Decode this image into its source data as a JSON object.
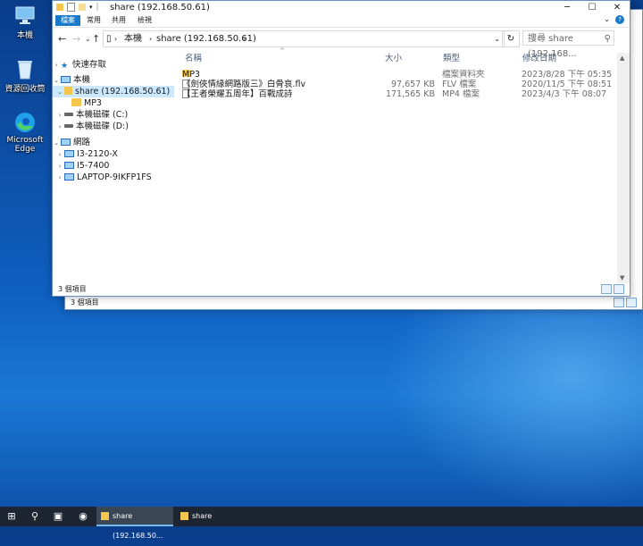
{
  "desktop": {
    "icons": [
      {
        "label": "本機"
      },
      {
        "label": "資源回收筒"
      },
      {
        "label": "Microsoft Edge"
      }
    ]
  },
  "back_window": {
    "status": "3 個項目"
  },
  "window": {
    "title": "share (192.168.50.61)",
    "ribbon_tabs": [
      "檔案",
      "常用",
      "共用",
      "檢視"
    ],
    "address": {
      "segments": [
        "本機",
        "share (192.168.50.61)"
      ]
    },
    "search_placeholder": "搜尋 share (192.168.50.61)",
    "search_display": "搜尋 share (192.168...",
    "nav_pane": [
      {
        "label": "快速存取"
      },
      {
        "label": "本機"
      },
      {
        "label": "share (192.168.50.61)"
      },
      {
        "label": "MP3"
      },
      {
        "label": "本機磁碟 (C:)"
      },
      {
        "label": "本機磁碟 (D:)"
      },
      {
        "label": "網路"
      },
      {
        "label": "I3-2120-X"
      },
      {
        "label": "I5-7400"
      },
      {
        "label": "LAPTOP-9IKFP1FS"
      }
    ],
    "columns": {
      "name": "名稱",
      "size": "大小",
      "type": "類型",
      "date": "修改日期"
    },
    "files": [
      {
        "name": "MP3",
        "size": "",
        "type": "檔案資料夾",
        "date": "2023/8/28 下午 05:35"
      },
      {
        "name": "《劍俠情緣網路版三》白骨哀.flv",
        "size": "97,657 KB",
        "type": "FLV 檔案",
        "date": "2020/11/5 下午 08:51"
      },
      {
        "name": "【王者榮耀五周年】百戰成詩",
        "size": "171,565 KB",
        "type": "MP4 檔案",
        "date": "2023/4/3 下午 08:07"
      }
    ],
    "status": "3 個項目"
  },
  "taskbar": {
    "apps": [
      {
        "label": "share (192.168.50..."
      },
      {
        "label": "share"
      }
    ]
  }
}
